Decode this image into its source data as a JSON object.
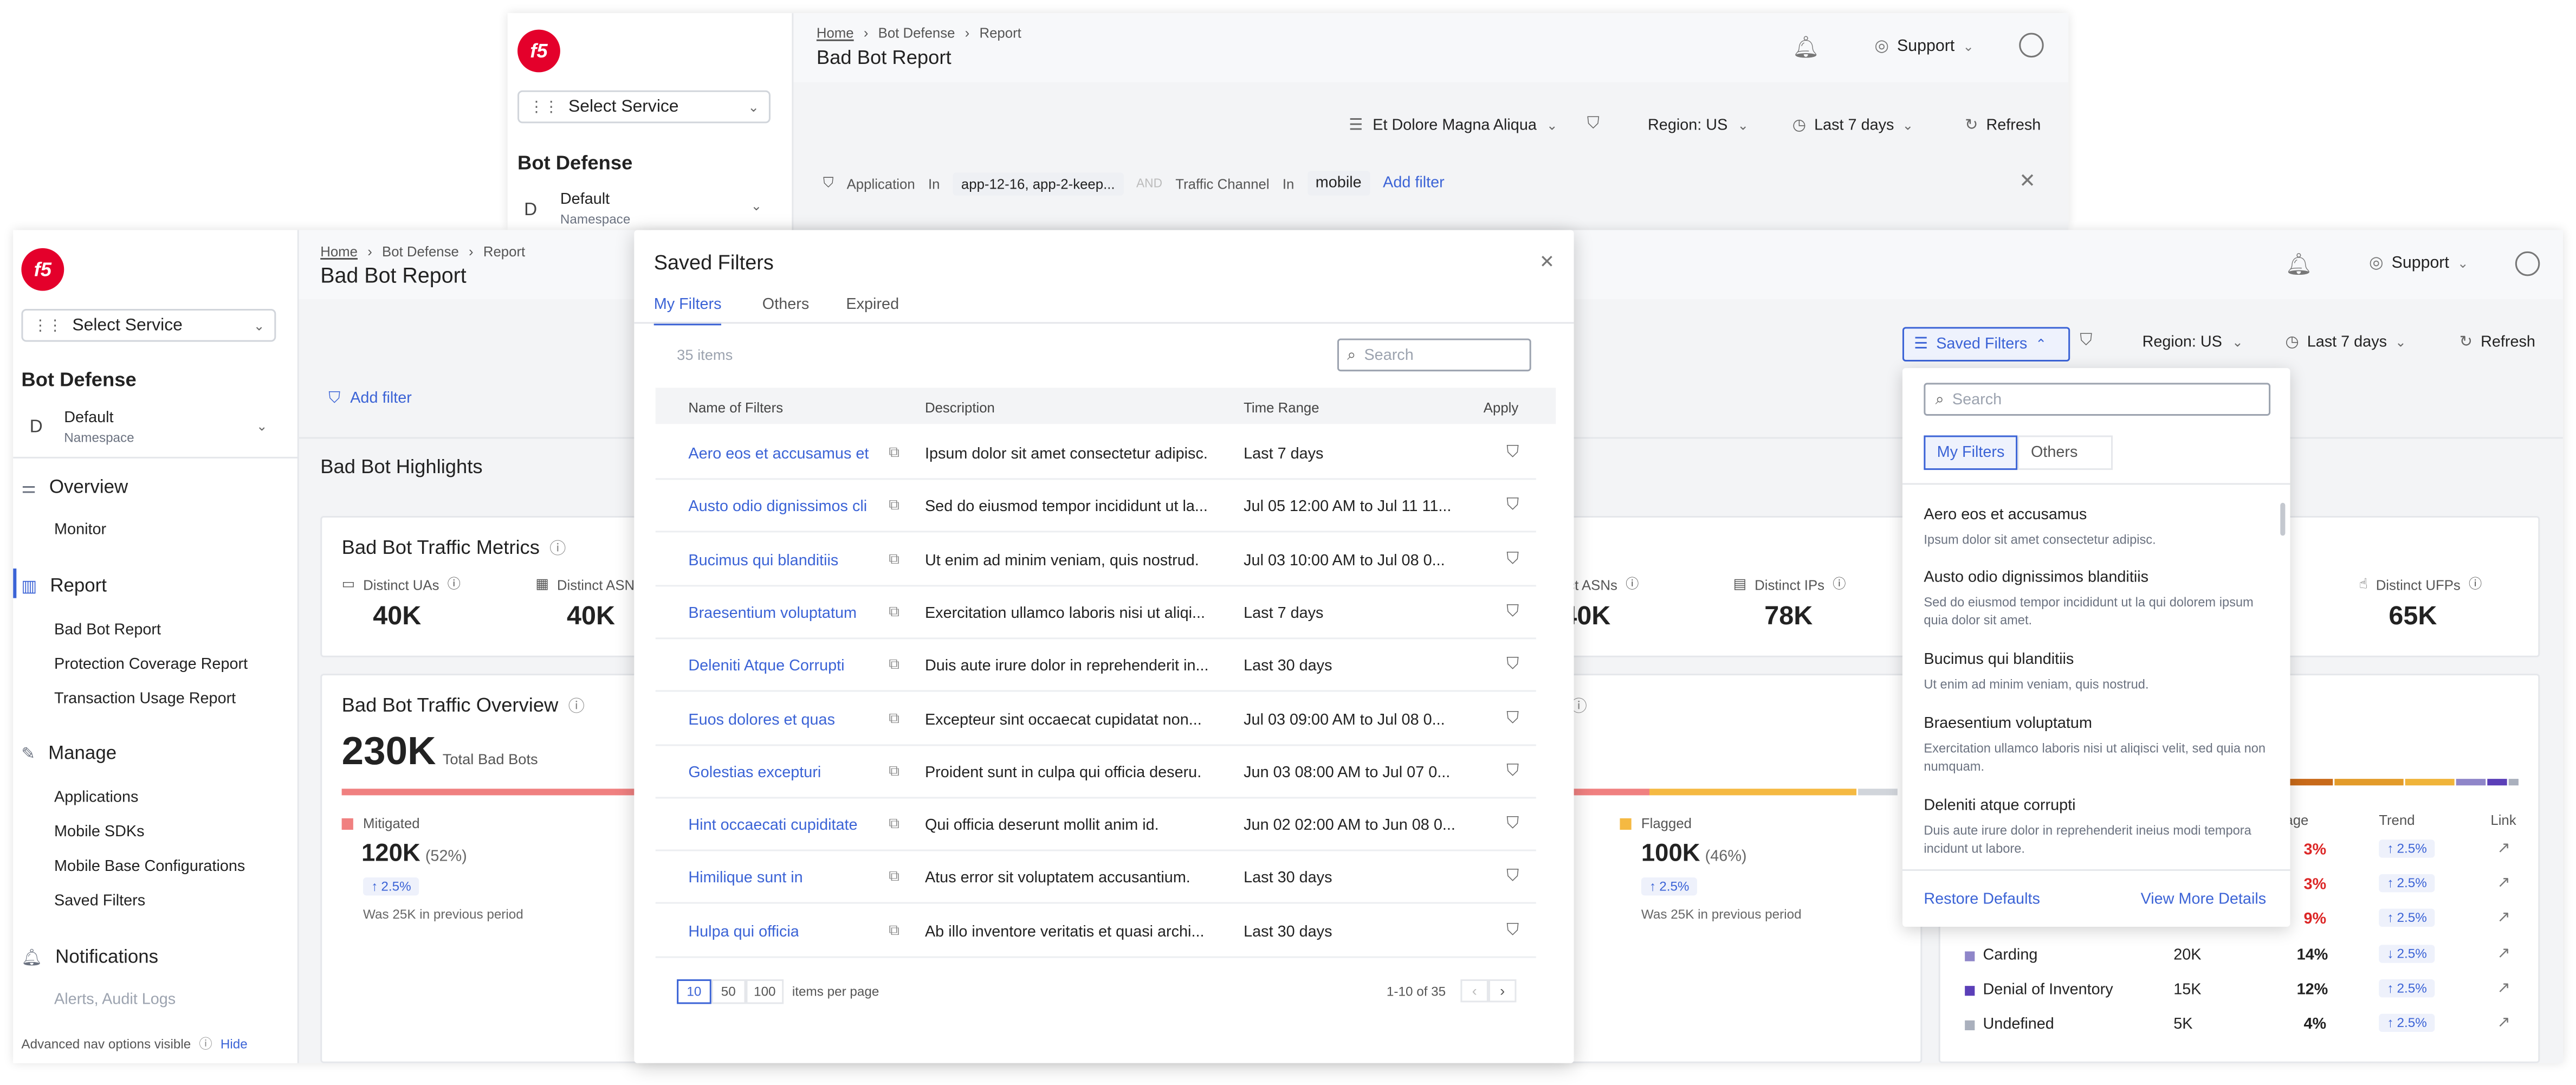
{
  "back": {
    "breadcrumb": [
      "Home",
      "Bot Defense",
      "Report"
    ],
    "title": "Bad Bot Report",
    "select_service": "Select Service",
    "section": "Bot Defense",
    "ns_initial": "D",
    "ns_name": "Default",
    "ns_sub": "Namespace",
    "support": "Support",
    "app_select": "Et Dolore Magna Aliqua",
    "region": "Region: US",
    "range": "Last 7 days",
    "refresh": "Refresh",
    "filter_app_key": "Application",
    "filter_in": "In",
    "filter_app_val": "app-12-16, app-2-keep...",
    "filter_and": "AND",
    "filter_tc_key": "Traffic Channel",
    "filter_tc_in": "In",
    "filter_tc_val": "mobile",
    "add_filter": "Add filter"
  },
  "front": {
    "breadcrumb": [
      "Home",
      "Bot Defense",
      "Report"
    ],
    "title": "Bad Bot Report",
    "select_service": "Select Service",
    "section": "Bot Defense",
    "ns_initial": "D",
    "ns_name": "Default",
    "ns_sub": "Namespace",
    "nav": {
      "overview": "Overview",
      "monitor": "Monitor",
      "report": "Report",
      "bad_bot_report": "Bad Bot Report",
      "protection_report": "Protection Coverage Report",
      "transaction_report": "Transaction Usage Report",
      "manage": "Manage",
      "applications": "Applications",
      "mobile_sdks": "Mobile SDKs",
      "mobile_base": "Mobile Base Configurations",
      "saved_filters": "Saved Filters",
      "notifications": "Notifications",
      "alerts": "Alerts, Audit Logs",
      "footer_text": "Advanced nav options visible",
      "hide": "Hide"
    },
    "support": "Support",
    "saved_filters_btn": "Saved Filters",
    "region": "Region: US",
    "range": "Last 7 days",
    "refresh": "Refresh",
    "add_filter": "Add filter",
    "highlights": "Bad Bot Highlights",
    "metrics_title": "Bad Bot Traffic Metrics",
    "metrics": [
      {
        "label": "Distinct UAs",
        "value": "40K"
      },
      {
        "label": "Distinct ASNs",
        "value": "40K"
      },
      {
        "label": "Distinct ASNs",
        "value": "40K"
      },
      {
        "label": "Distinct IPs",
        "value": "78K"
      },
      {
        "label": "Distinct UFPs",
        "value": "65K"
      }
    ],
    "overview_title": "Bad Bot Traffic Overview",
    "total_value": "230K",
    "total_label": "Total Bad Bots",
    "mitigated_label": "Mitigated",
    "mitigated_value": "120K",
    "mitigated_pct": "(52%)",
    "mitigated_badge": "2.5%",
    "mitigated_prev": "Was 25K in previous period",
    "flagged_label": "Flagged",
    "flagged_value": "100K",
    "flagged_pct": "(46%)",
    "flagged_badge": "2.5%",
    "flagged_prev": "Was 25K in previous period",
    "cat_headers": {
      "age": "age",
      "trend": "Trend",
      "link": "Link"
    },
    "categories": [
      {
        "name": "",
        "count": "",
        "pct": "3%",
        "pct_color": "#dc2626",
        "trend": "2.5%",
        "dir": "up"
      },
      {
        "name": "",
        "count": "",
        "pct": "3%",
        "pct_color": "#dc2626",
        "trend": "2.5%",
        "dir": "up"
      },
      {
        "name": "",
        "count": "",
        "pct": "9%",
        "pct_color": "#dc2626",
        "trend": "2.5%",
        "dir": "up"
      },
      {
        "name": "Carding",
        "count": "20K",
        "pct": "14%",
        "pct_color": "#222",
        "trend": "2.5%",
        "dir": "down",
        "color": "#8f86c9"
      },
      {
        "name": "Denial of Inventory",
        "count": "15K",
        "pct": "12%",
        "pct_color": "#222",
        "trend": "2.5%",
        "dir": "up",
        "color": "#5b3fb8"
      },
      {
        "name": "Undefined",
        "count": "5K",
        "pct": "4%",
        "pct_color": "#222",
        "trend": "2.5%",
        "dir": "up",
        "color": "#aab0bd"
      }
    ]
  },
  "modal": {
    "title": "Saved Filters",
    "tabs": [
      "My Filters",
      "Others",
      "Expired"
    ],
    "count": "35 items",
    "search_placeholder": "Search",
    "headers": [
      "Name of Filters",
      "Description",
      "Time Range",
      "Apply"
    ],
    "rows": [
      {
        "name": "Aero eos et accusamus et",
        "desc": "Ipsum dolor sit amet consectetur adipisc.",
        "range": "Last 7 days"
      },
      {
        "name": "Austo odio dignissimos cli",
        "desc": "Sed do eiusmod tempor incididunt ut la...",
        "range": "Jul 05 12:00 AM to Jul 11 11..."
      },
      {
        "name": "Bucimus qui blanditiis",
        "desc": "Ut enim ad minim veniam, quis nostrud.",
        "range": "Jul 03 10:00 AM to Jul 08 0..."
      },
      {
        "name": "Braesentium voluptatum",
        "desc": "Exercitation ullamco laboris nisi ut aliqi...",
        "range": "Last 7 days"
      },
      {
        "name": "Deleniti Atque Corrupti",
        "desc": "Duis aute irure dolor in reprehenderit in...",
        "range": "Last 30 days"
      },
      {
        "name": "Euos dolores et quas",
        "desc": "Excepteur sint occaecat cupidatat non...",
        "range": "Jul 03 09:00 AM to Jul 08 0..."
      },
      {
        "name": "Golestias excepturi",
        "desc": "Proident sunt in culpa qui officia deseru.",
        "range": "Jun 03 08:00 AM to Jul 07 0..."
      },
      {
        "name": "Hint occaecati cupiditate",
        "desc": "Qui officia deserunt mollit anim id.",
        "range": "Jun 02 02:00 AM to Jun 08 0..."
      },
      {
        "name": "Himilique sunt in",
        "desc": "Atus error sit voluptatem accusantium.",
        "range": "Last 30 days"
      },
      {
        "name": "Hulpa qui officia",
        "desc": "Ab illo inventore veritatis et quasi archi...",
        "range": "Last 30 days"
      }
    ],
    "page_sizes": [
      "10",
      "50",
      "100"
    ],
    "per_page": "items per page",
    "range_text": "1-10 of 35"
  },
  "dropdown": {
    "search_placeholder": "Search",
    "tabs": [
      "My Filters",
      "Others"
    ],
    "items": [
      {
        "name": "Aero eos et accusamus",
        "desc": "Ipsum dolor sit amet consectetur adipisc."
      },
      {
        "name": "Austo odio dignissimos blanditiis",
        "desc": "Sed do eiusmod tempor incididunt ut la qui dolorem ipsum quia dolor sit amet."
      },
      {
        "name": "Bucimus qui blanditiis",
        "desc": "Ut enim ad minim veniam, quis nostrud."
      },
      {
        "name": "Braesentium voluptatum",
        "desc": "Exercitation ullamco laboris nisi ut aliqisci velit, sed quia non numquam."
      },
      {
        "name": "Deleniti atque corrupti",
        "desc": "Duis aute irure dolor in reprehenderit ineius modi tempora incidunt ut labore."
      }
    ],
    "restore": "Restore Defaults",
    "view_more": "View More Details"
  }
}
